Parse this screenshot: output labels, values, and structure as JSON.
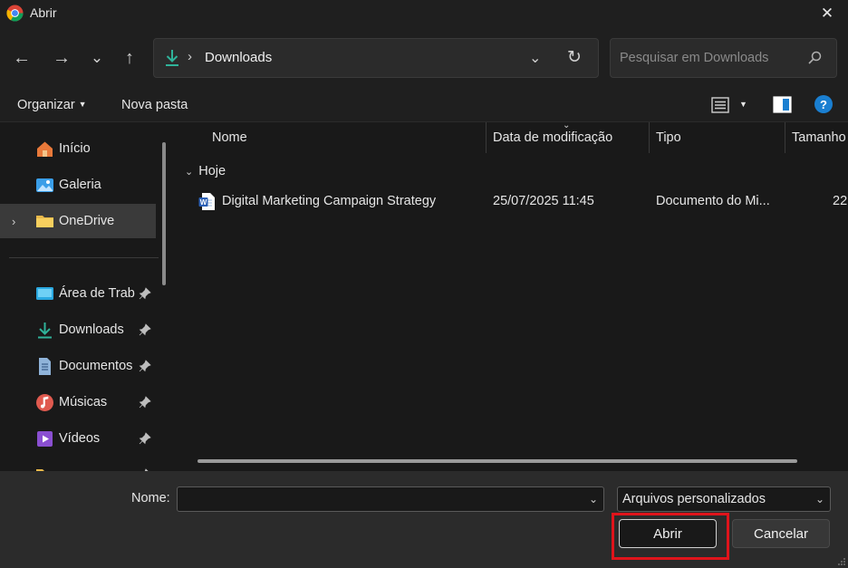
{
  "window": {
    "title": "Abrir",
    "close_icon": "close-icon"
  },
  "nav": {
    "back_icon": "←",
    "forward_icon": "→",
    "recent_icon": "⌄",
    "up_icon": "↑",
    "separator": "›",
    "path": "Downloads",
    "dropdown": "⌄",
    "refresh": "↻",
    "search_placeholder": "Pesquisar em Downloads"
  },
  "commands": {
    "organize": "Organizar",
    "new_folder": "Nova pasta",
    "help": "?"
  },
  "sidebar": {
    "items": [
      {
        "label": "Início",
        "icon": "home-icon"
      },
      {
        "label": "Galeria",
        "icon": "gallery-icon"
      },
      {
        "label": "OneDrive",
        "icon": "folder-icon",
        "selected": true,
        "expand": "›"
      },
      {
        "label": "Área de Trab",
        "icon": "desktop-icon",
        "pinned": true
      },
      {
        "label": "Downloads",
        "icon": "download-icon",
        "pinned": true
      },
      {
        "label": "Documentos",
        "icon": "documents-icon",
        "pinned": true
      },
      {
        "label": "Músicas",
        "icon": "music-icon",
        "pinned": true
      },
      {
        "label": "Vídeos",
        "icon": "video-icon",
        "pinned": true
      }
    ]
  },
  "table": {
    "columns": [
      "Nome",
      "Data de modificação",
      "Tipo",
      "Tamanho"
    ],
    "group": "Hoje",
    "group_chevron": "⌄",
    "rows": [
      {
        "name": "Digital Marketing Campaign Strategy",
        "date": "25/07/2025 11:45",
        "type": "Documento do Mi...",
        "size": "22"
      }
    ]
  },
  "footer": {
    "name_label": "Nome:",
    "name_value": "",
    "filter_value": "Arquivos personalizados",
    "open_label": "Abrir",
    "cancel_label": "Cancelar"
  },
  "colors": {
    "accent_blue": "#1a7fd1",
    "highlight_red": "#e0141b",
    "download_green": "#2fb39a"
  }
}
